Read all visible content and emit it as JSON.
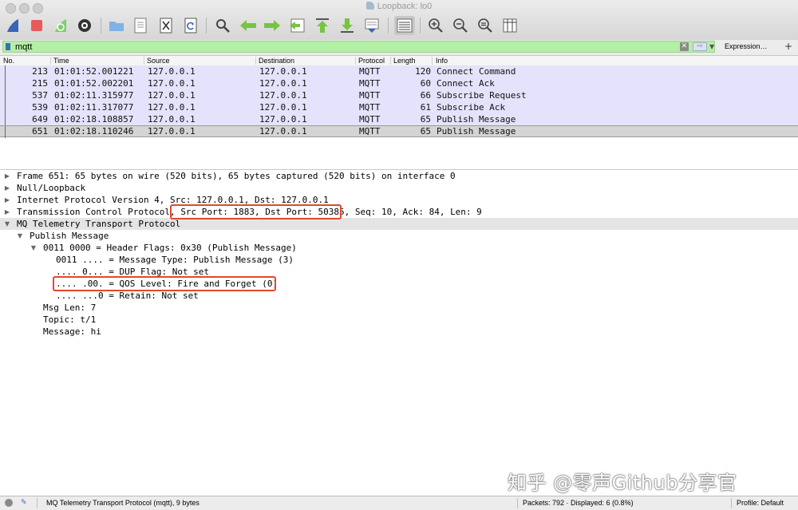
{
  "window": {
    "title": "Loopback: lo0"
  },
  "toolbar": {
    "buttons": [
      "start-capture-icon",
      "stop-capture-icon",
      "restart-capture-icon",
      "capture-options-icon",
      "open-file-icon",
      "save-file-icon",
      "close-file-icon",
      "reload-file-icon",
      "find-packet-icon",
      "go-back-icon",
      "go-forward-icon",
      "go-to-packet-icon",
      "go-first-icon",
      "go-last-icon",
      "autoscroll-icon",
      "colorize-icon",
      "zoom-in-icon",
      "zoom-out-icon",
      "zoom-normal-icon",
      "resize-columns-icon"
    ]
  },
  "filter": {
    "value": "mqtt",
    "expression_label": "Expression…",
    "add_label": "+"
  },
  "packet_list": {
    "columns": [
      "No.",
      "Time",
      "Source",
      "Destination",
      "Protocol",
      "Length",
      "Info"
    ],
    "rows": [
      {
        "no": "213",
        "time": "01:01:52.001221",
        "source": "127.0.0.1",
        "destination": "127.0.0.1",
        "protocol": "MQTT",
        "length": "120",
        "info": "Connect Command"
      },
      {
        "no": "215",
        "time": "01:01:52.002201",
        "source": "127.0.0.1",
        "destination": "127.0.0.1",
        "protocol": "MQTT",
        "length": "60",
        "info": "Connect Ack"
      },
      {
        "no": "537",
        "time": "01:02:11.315977",
        "source": "127.0.0.1",
        "destination": "127.0.0.1",
        "protocol": "MQTT",
        "length": "66",
        "info": "Subscribe Request"
      },
      {
        "no": "539",
        "time": "01:02:11.317077",
        "source": "127.0.0.1",
        "destination": "127.0.0.1",
        "protocol": "MQTT",
        "length": "61",
        "info": "Subscribe Ack"
      },
      {
        "no": "649",
        "time": "01:02:18.108857",
        "source": "127.0.0.1",
        "destination": "127.0.0.1",
        "protocol": "MQTT",
        "length": "65",
        "info": "Publish Message"
      },
      {
        "no": "651",
        "time": "01:02:18.110246",
        "source": "127.0.0.1",
        "destination": "127.0.0.1",
        "protocol": "MQTT",
        "length": "65",
        "info": "Publish Message"
      }
    ],
    "selected_no": "651"
  },
  "details": {
    "frame": "Frame 651: 65 bytes on wire (520 bits), 65 bytes captured (520 bits) on interface 0",
    "null_loopback": "Null/Loopback",
    "ip": "Internet Protocol Version 4, Src: 127.0.0.1, Dst: 127.0.0.1",
    "tcp_prefix": "Transmission Control Protocol, ",
    "tcp_ports": "Src Port: 1883, Dst Port: 50385,",
    "tcp_suffix": " Seq: 10, Ack: 84, Len: 9",
    "mqtt": "MQ Telemetry Transport Protocol",
    "publish_message": "Publish Message",
    "header_flags": "0011 0000 = Header Flags: 0x30 (Publish Message)",
    "message_type": "0011 .... = Message Type: Publish Message (3)",
    "dup_flag": ".... 0... = DUP Flag: Not set",
    "qos_level": ".... .00. = QOS Level: Fire and Forget (0)",
    "retain": ".... ...0 = Retain: Not set",
    "msg_len": "Msg Len: 7",
    "topic": "Topic: t/1",
    "message": "Message: hi"
  },
  "watermark": "知乎 @零声Github分享官",
  "status": {
    "protocol_text": "MQ Telemetry Transport Protocol (mqtt), 9 bytes",
    "packets_text": "Packets: 792 · Displayed: 6 (0.8%)",
    "profile_text": "Profile: Default"
  },
  "colors": {
    "filter_valid": "#b3f0a6",
    "row_mqtt": "#e4e3fb",
    "row_selected": "#d4d4d4",
    "highlight_box": "#e2492a"
  }
}
